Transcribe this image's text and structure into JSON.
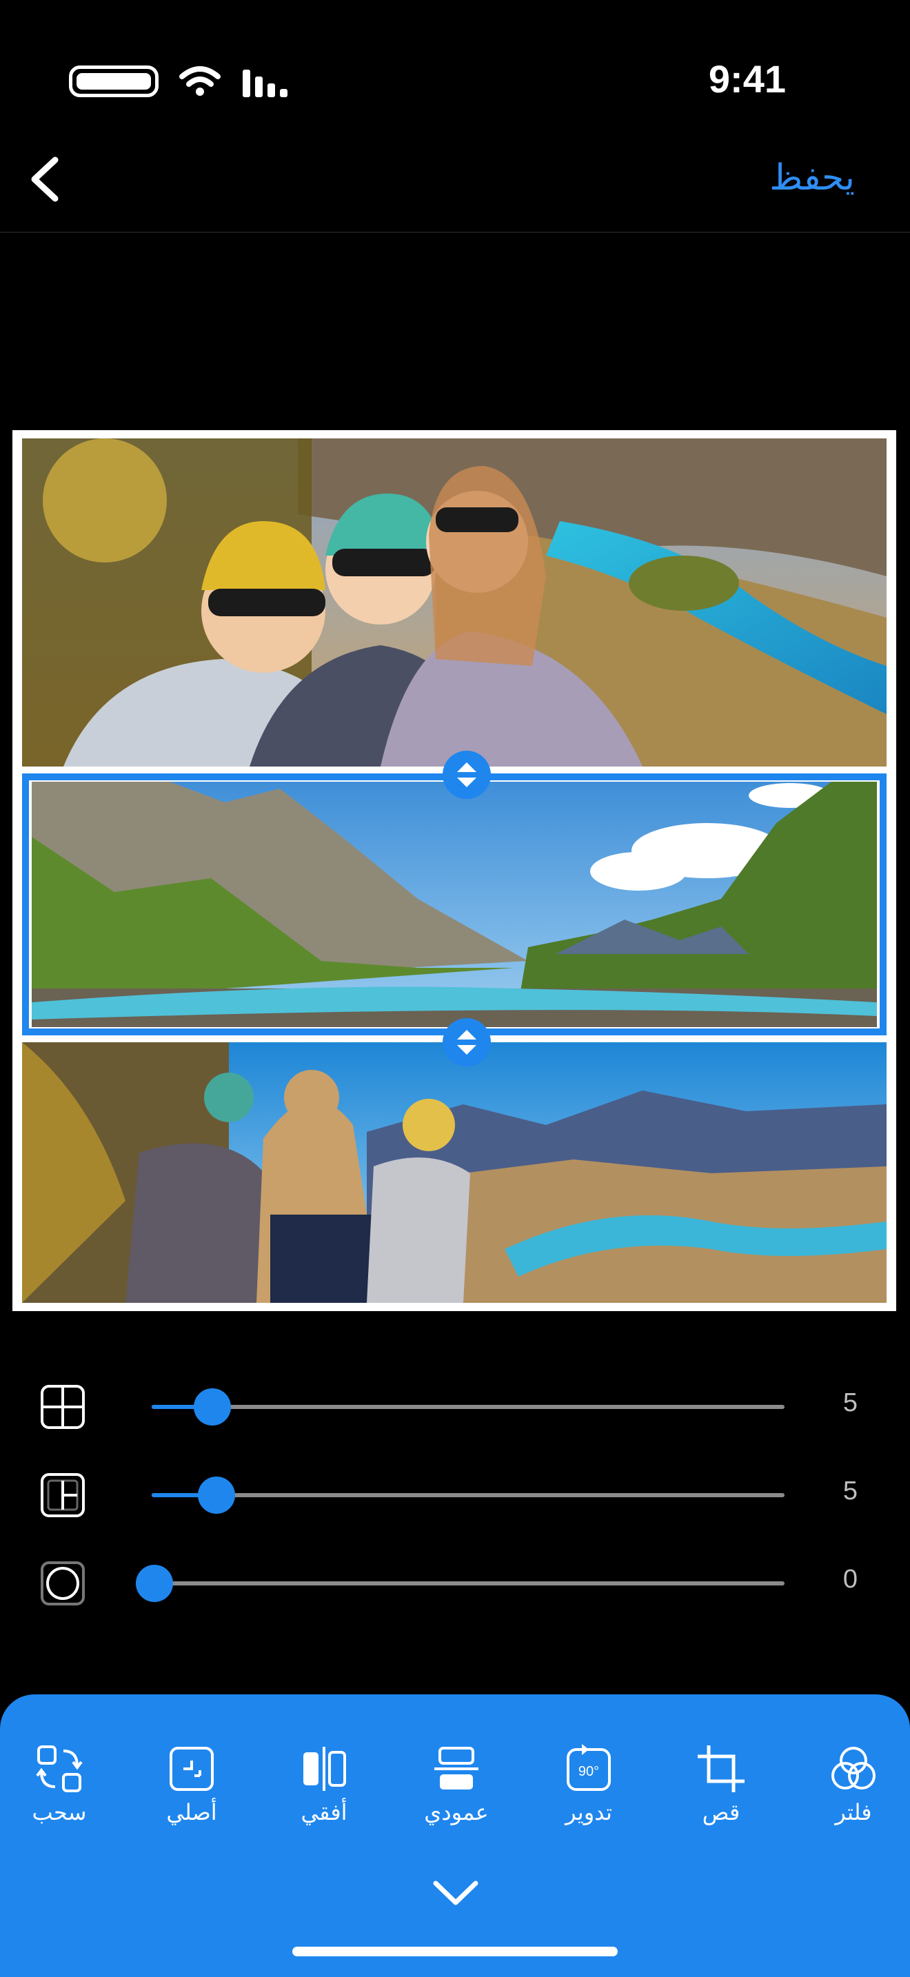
{
  "status_bar": {
    "time": "9:41"
  },
  "nav": {
    "save_label": "يحفظ"
  },
  "sliders": [
    {
      "name": "inner-border",
      "icon": "grid-inner-icon",
      "value": "5",
      "level": 0.1
    },
    {
      "name": "outer-border",
      "icon": "grid-outer-icon",
      "value": "5",
      "level": 0.105
    },
    {
      "name": "corner-radius",
      "icon": "circle-radius-icon",
      "value": "0",
      "level": 0.0
    }
  ],
  "toolbar": {
    "items": [
      {
        "label": "سحب",
        "icon": "swap-icon"
      },
      {
        "label": "أصلي",
        "icon": "original-icon"
      },
      {
        "label": "أفقي",
        "icon": "flip-horizontal-icon"
      },
      {
        "label": "عمودي",
        "icon": "flip-vertical-icon"
      },
      {
        "label": "تدوير",
        "icon": "rotate-90-icon"
      },
      {
        "label": "قص",
        "icon": "crop-icon"
      },
      {
        "label": "فلتر",
        "icon": "filter-icon"
      }
    ]
  },
  "colors": {
    "accent": "#1f86ee",
    "save": "#2e8ef5",
    "background": "#000000"
  }
}
